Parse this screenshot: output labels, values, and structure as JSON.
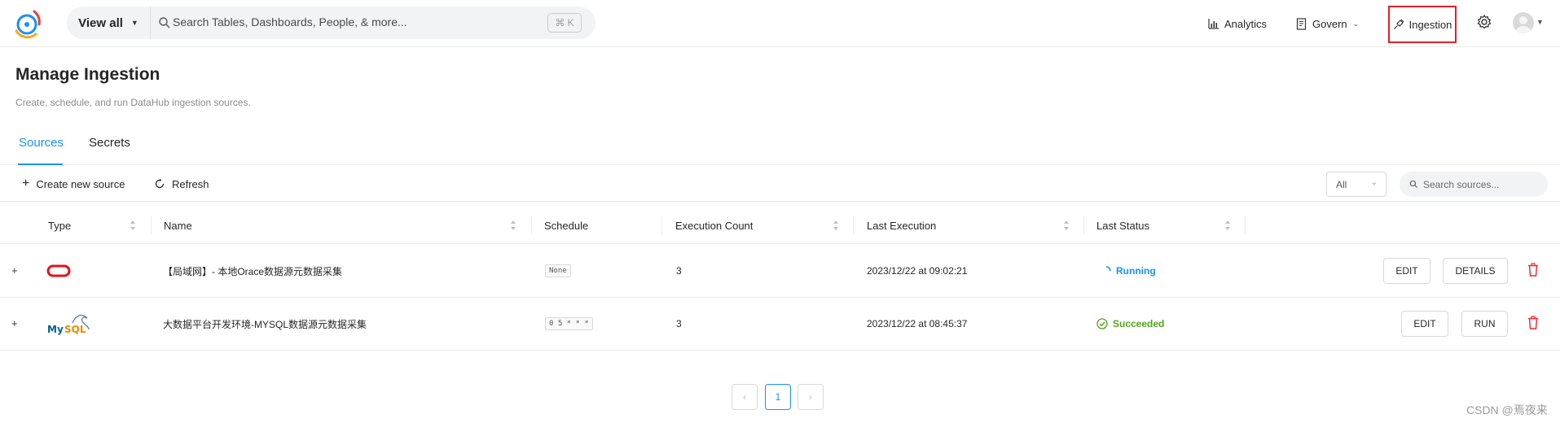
{
  "header": {
    "view_all_label": "View all",
    "search_placeholder": "Search Tables, Dashboards, People, & more...",
    "shortcut_hint": "⌘ K",
    "nav": {
      "analytics": "Analytics",
      "govern": "Govern",
      "ingestion": "Ingestion"
    }
  },
  "page": {
    "title": "Manage Ingestion",
    "description": "Create, schedule, and run DataHub ingestion sources."
  },
  "tabs": [
    {
      "label": "Sources",
      "active": true
    },
    {
      "label": "Secrets",
      "active": false
    }
  ],
  "toolbar": {
    "create_label": "Create new source",
    "refresh_label": "Refresh",
    "filter_value": "All",
    "search_placeholder": "Search sources..."
  },
  "table": {
    "columns": [
      "Type",
      "Name",
      "Schedule",
      "Execution Count",
      "Last Execution",
      "Last Status"
    ],
    "rows": [
      {
        "type_icon": "oracle-logo",
        "name": "【局域网】- 本地Orace数据源元数据采集",
        "schedule": "None",
        "execution_count": "3",
        "last_execution": "2023/12/22 at 09:02:21",
        "last_status": "Running",
        "actions": [
          "EDIT",
          "DETAILS"
        ]
      },
      {
        "type_icon": "mysql-logo",
        "name": "大数据平台开发环境-MYSQL数据源元数据采集",
        "schedule": "0 5 * * *",
        "execution_count": "3",
        "last_execution": "2023/12/22 at 08:45:37",
        "last_status": "Succeeded",
        "actions": [
          "EDIT",
          "RUN"
        ]
      }
    ]
  },
  "pagination": {
    "current_page": "1"
  },
  "watermark": "CSDN @焉夜来",
  "colors": {
    "accent": "#1890ff",
    "success": "#52a41e",
    "danger": "#f5222d",
    "highlight_box": "#e0202a",
    "oracle": "#e3141b"
  }
}
